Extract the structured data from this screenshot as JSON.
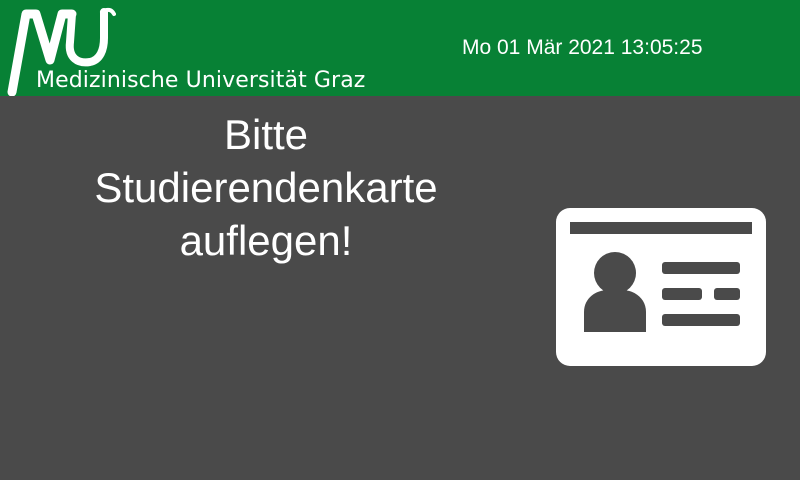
{
  "header": {
    "logo_text": "Medizinische Universität Graz",
    "logo_icon": "mu-logo-icon",
    "datetime": "Mo 01 Mär 2021 13:05:25",
    "background_color": "#078135"
  },
  "main": {
    "prompt_lines": [
      "Bitte",
      "Studierendenkarte",
      "auflegen!"
    ],
    "card_icon": "id-card-icon",
    "background_color": "#4a4a4a",
    "text_color": "#ffffff"
  }
}
